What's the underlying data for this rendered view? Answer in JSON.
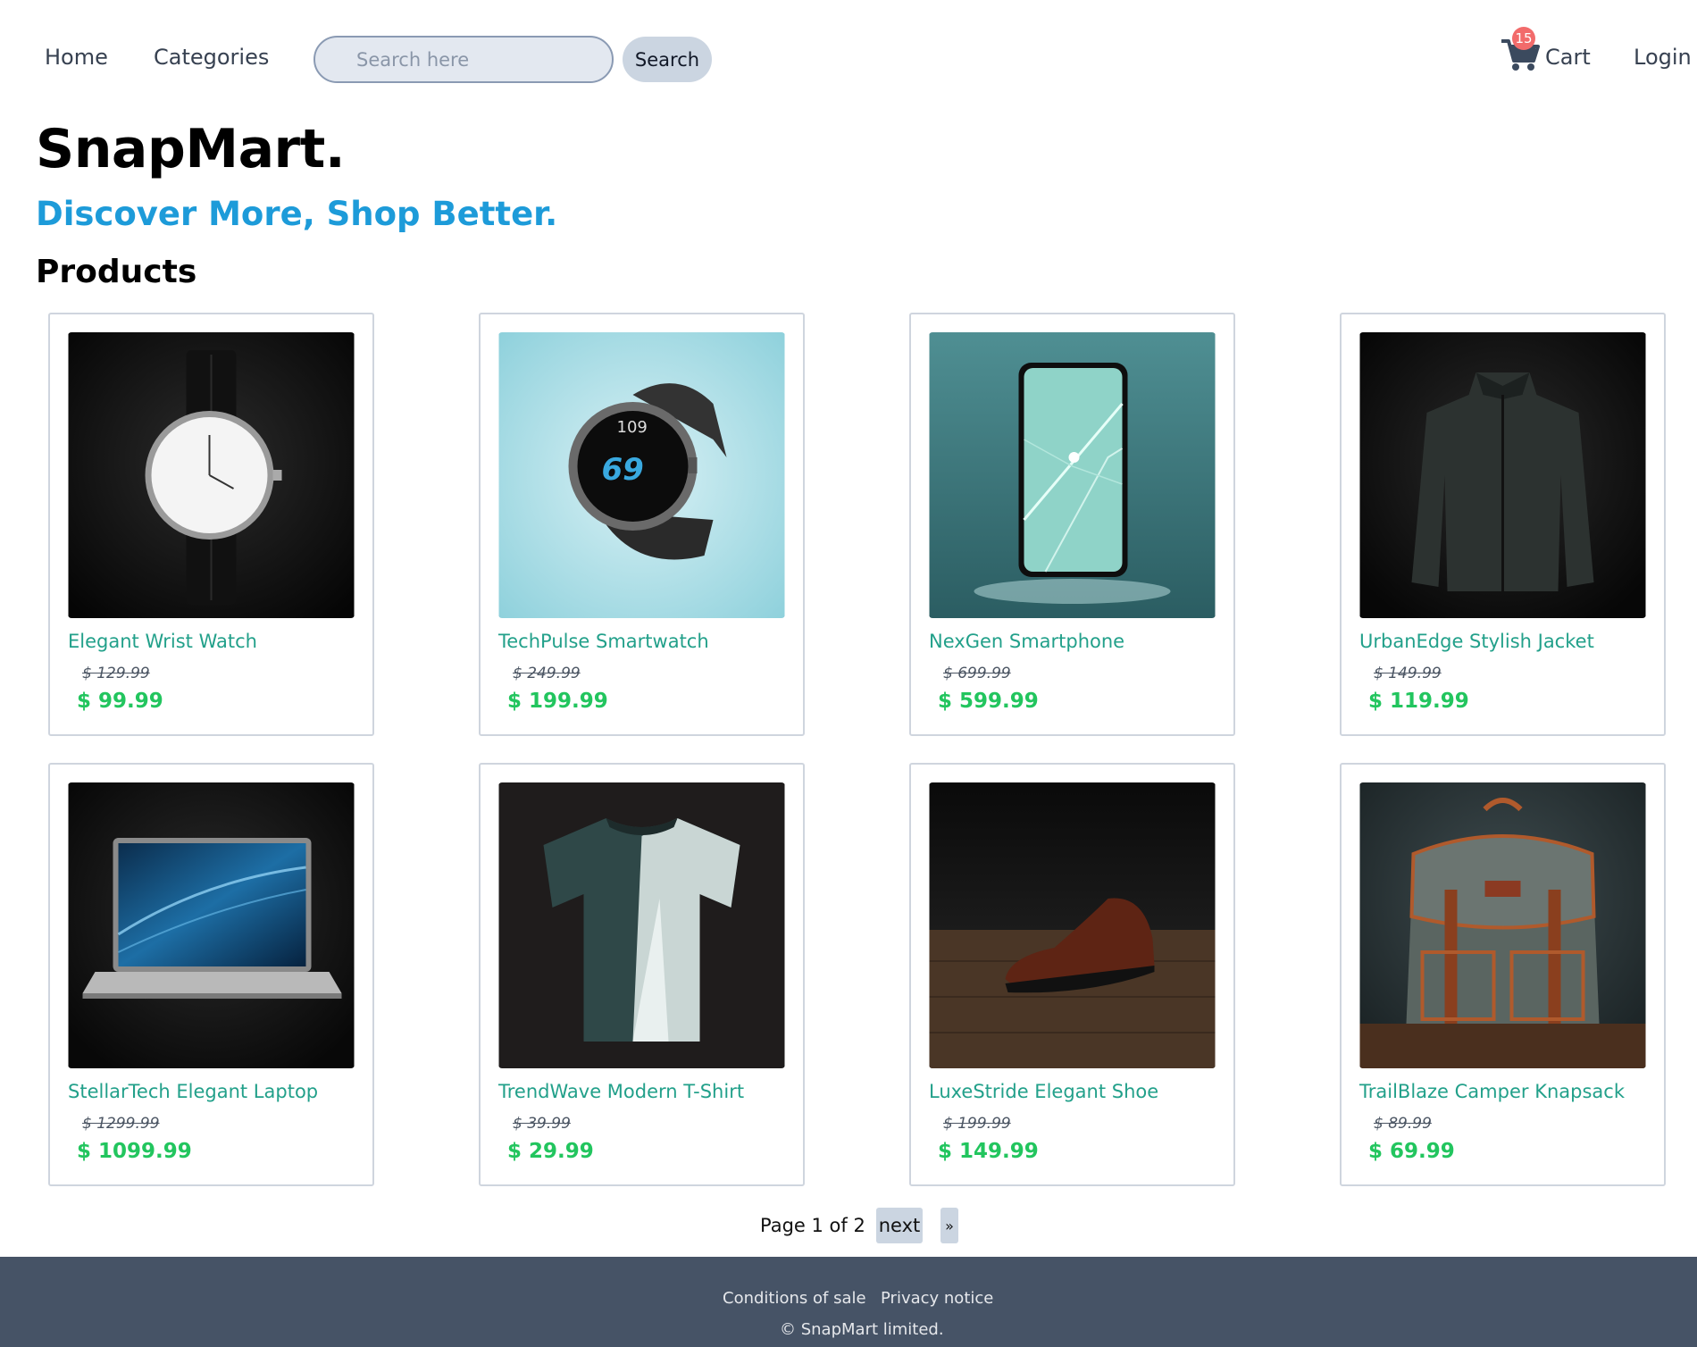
{
  "nav": {
    "home": "Home",
    "categories": "Categories",
    "search_placeholder": "Search here",
    "search_button": "Search",
    "cart_count": "15",
    "cart_label": "Cart",
    "login": "Login"
  },
  "header": {
    "brand": "SnapMart.",
    "tagline": "Discover More, Shop Better.",
    "section_title": "Products"
  },
  "products": [
    {
      "name": "Elegant Wrist Watch",
      "old_price": "$ 129.99",
      "price": "$ 99.99",
      "image": "wrist-watch-image"
    },
    {
      "name": "TechPulse Smartwatch",
      "old_price": "$ 249.99",
      "price": "$ 199.99",
      "image": "smartwatch-image"
    },
    {
      "name": "NexGen Smartphone",
      "old_price": "$ 699.99",
      "price": "$ 599.99",
      "image": "smartphone-image"
    },
    {
      "name": "UrbanEdge Stylish Jacket",
      "old_price": "$ 149.99",
      "price": "$ 119.99",
      "image": "jacket-image"
    },
    {
      "name": "StellarTech Elegant Laptop",
      "old_price": "$ 1299.99",
      "price": "$ 1099.99",
      "image": "laptop-image"
    },
    {
      "name": "TrendWave Modern T-Shirt",
      "old_price": "$ 39.99",
      "price": "$ 29.99",
      "image": "tshirt-image"
    },
    {
      "name": "LuxeStride Elegant Shoe",
      "old_price": "$ 199.99",
      "price": "$ 149.99",
      "image": "shoe-image"
    },
    {
      "name": "TrailBlaze Camper Knapsack",
      "old_price": "$ 89.99",
      "price": "$ 69.99",
      "image": "knapsack-image"
    }
  ],
  "pagination": {
    "info": "Page 1 of 2",
    "next": "next",
    "last": "»"
  },
  "footer": {
    "conditions": "Conditions of sale",
    "privacy": "Privacy notice",
    "copyright": "© SnapMart limited."
  },
  "colors": {
    "accent": "#1d9bd9",
    "product_name": "#22a08a",
    "price": "#22c55e",
    "footer_bg": "#465366",
    "badge": "#f26b6b"
  }
}
